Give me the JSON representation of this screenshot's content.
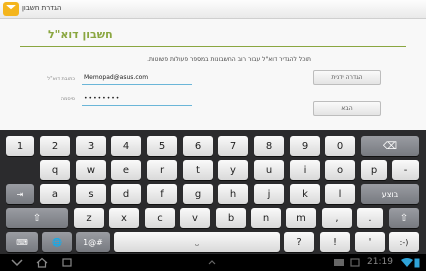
{
  "actionbar": {
    "title": "הגדרת חשבון"
  },
  "setup": {
    "heading": "חשבון דוא\"ל",
    "instruction": "תוכל להגדיר דוא\"ל עבור רוב החשבונות במספר פעולות פשוטות.",
    "email_label": "כתובת דוא\"ל",
    "email_value": "Memopad@asus.com",
    "password_label": "סיסמה",
    "password_value": "••••••••",
    "manual_setup_label": "הגדרה ידנית",
    "next_label": "הבא"
  },
  "keyboard": {
    "rows": [
      [
        "1",
        "2",
        "3",
        "4",
        "5",
        "6",
        "7",
        "8",
        "9",
        "0",
        "⌫"
      ],
      [
        "q",
        "w",
        "e",
        "r",
        "t",
        "y",
        "u",
        "i",
        "o",
        "p",
        "-"
      ],
      [
        "⇥",
        "a",
        "s",
        "d",
        "f",
        "g",
        "h",
        "j",
        "k",
        "l",
        "בוצע"
      ],
      [
        "⇧",
        "z",
        "x",
        "c",
        "v",
        "b",
        "n",
        "m",
        ",",
        ".",
        "⇧"
      ],
      [
        "⌨",
        "🌐",
        "1@#",
        "space",
        "?",
        "!",
        "'",
        ":-)"
      ]
    ]
  },
  "statusbar": {
    "time": "21:19"
  }
}
